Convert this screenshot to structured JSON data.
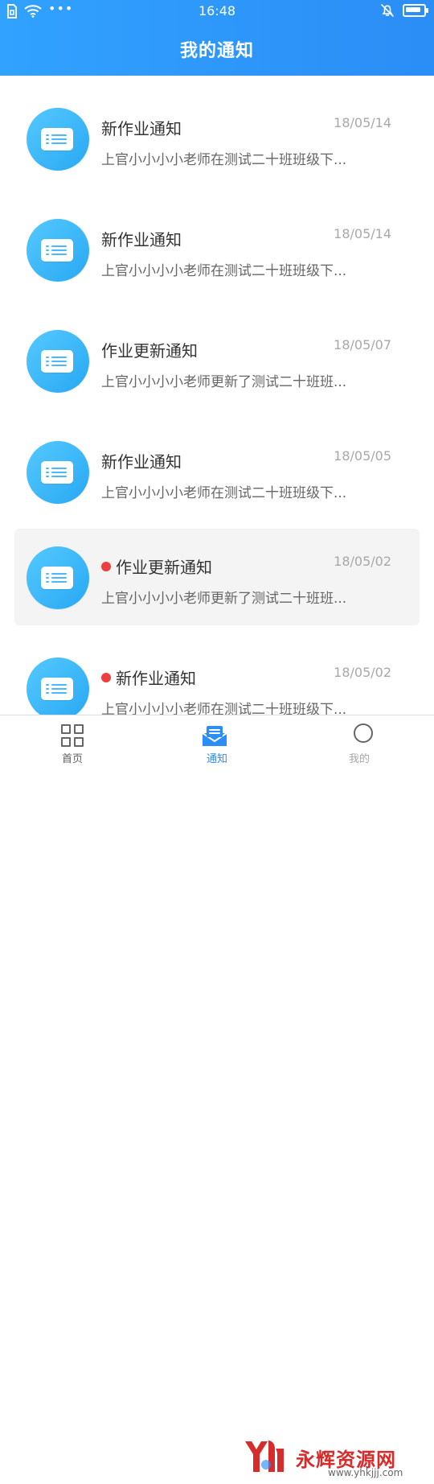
{
  "status_bar": {
    "time": "16:48",
    "left_icons": [
      "sim-icon",
      "wifi-icon",
      "more-dots-icon"
    ],
    "right_icons": [
      "mute-bell-icon",
      "battery-icon"
    ]
  },
  "header": {
    "title": "我的通知"
  },
  "notifications": [
    {
      "title": "新作业通知",
      "date": "18/05/14",
      "summary": "上官小小小小老师在测试二十班班级下...",
      "unread": false,
      "selected": false
    },
    {
      "title": "新作业通知",
      "date": "18/05/14",
      "summary": "上官小小小小老师在测试二十班班级下...",
      "unread": false,
      "selected": false
    },
    {
      "title": "作业更新通知",
      "date": "18/05/07",
      "summary": "上官小小小小老师更新了测试二十班班...",
      "unread": false,
      "selected": false
    },
    {
      "title": "新作业通知",
      "date": "18/05/05",
      "summary": "上官小小小小老师在测试二十班班级下...",
      "unread": false,
      "selected": false
    },
    {
      "title": "作业更新通知",
      "date": "18/05/02",
      "summary": "上官小小小小老师更新了测试二十班班...",
      "unread": true,
      "selected": true
    },
    {
      "title": "新作业通知",
      "date": "18/05/02",
      "summary": "上官小小小小老师在测试二十班班级下...",
      "unread": true,
      "selected": false
    }
  ],
  "tabs": {
    "home": {
      "label": "首页",
      "icon": "grid-icon"
    },
    "notice": {
      "label": "通知",
      "icon": "mail-icon",
      "active": true
    },
    "me": {
      "label": "我的",
      "icon": "profile-icon"
    }
  },
  "watermark": {
    "text": "永辉资源网",
    "url": "www.yhkjjj.com",
    "icon": "yh-logo-icon"
  },
  "colors": {
    "header_gradient_start": "#31a2ff",
    "header_gradient_end": "#2b8df6",
    "unread_dot": "#ef3e3e",
    "active_tab": "#2b8df6",
    "selected_row": "#f4f4f4"
  }
}
